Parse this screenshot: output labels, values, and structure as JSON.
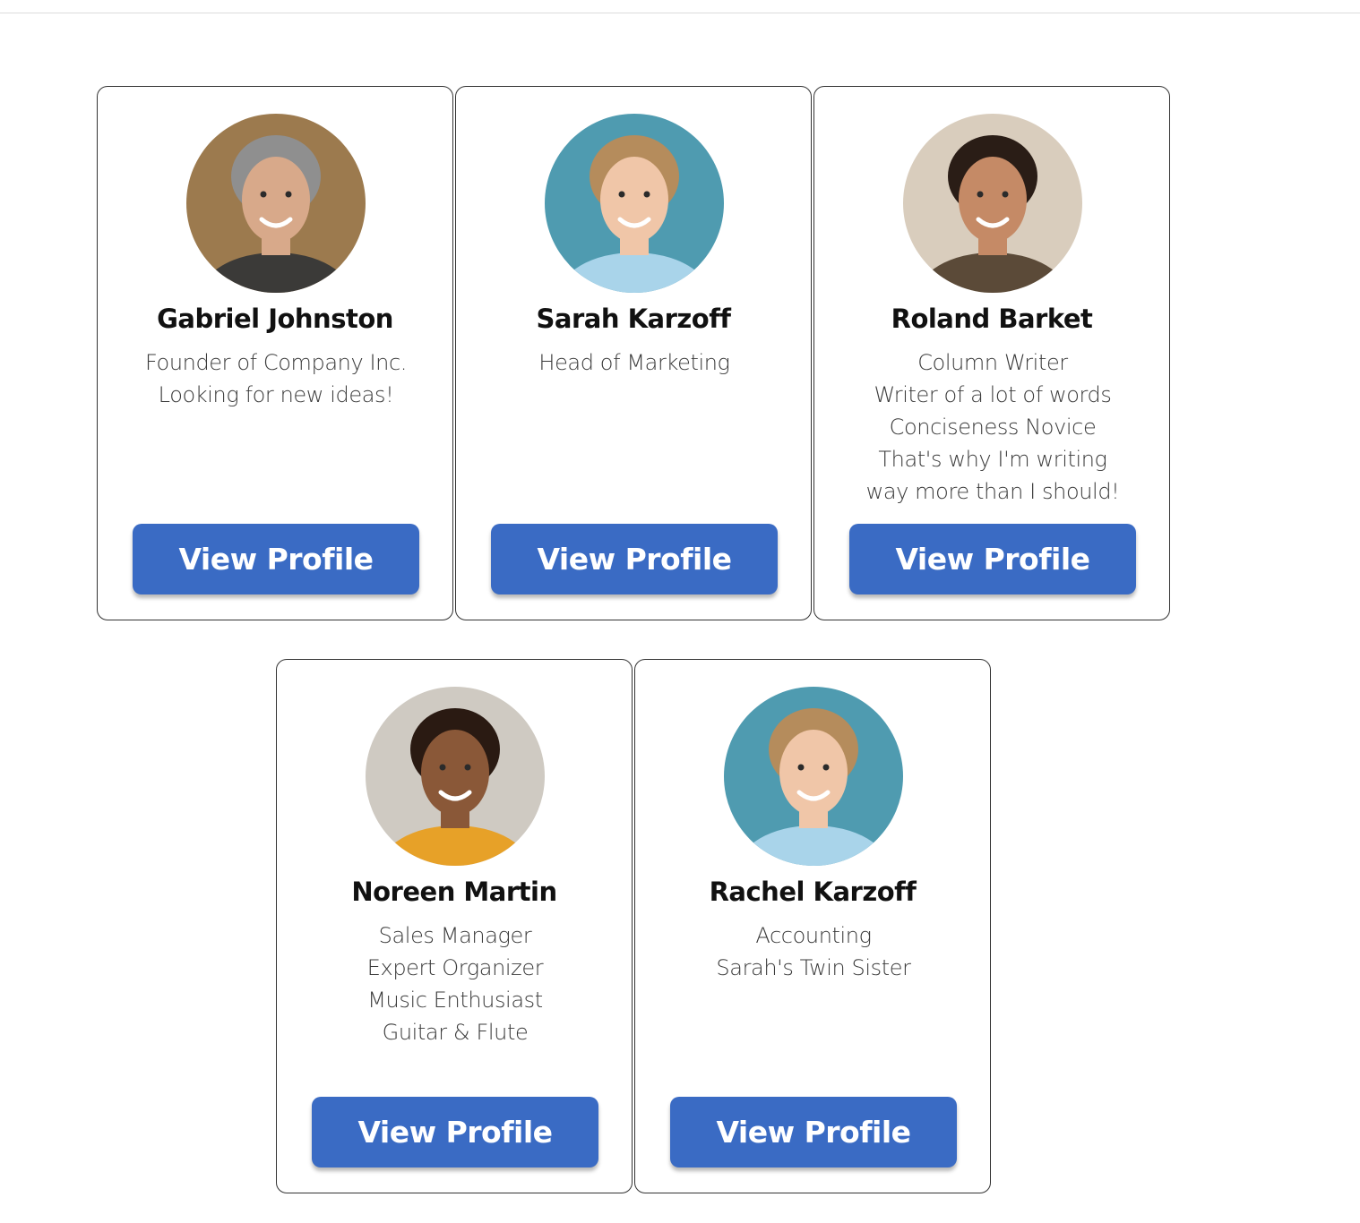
{
  "cards": [
    {
      "name": "Gabriel Johnston",
      "bio": [
        "Founder of Company Inc.",
        "Looking for new ideas!"
      ],
      "button_label": "View Profile",
      "photo": {
        "bg": "#9c7a4e",
        "skin": "#d8a98a",
        "hair": "#8f8f8f",
        "shirt": "#3b3a38"
      }
    },
    {
      "name": "Sarah Karzoff",
      "bio": [
        "Head of Marketing"
      ],
      "button_label": "View Profile",
      "photo": {
        "bg": "#4f9bb0",
        "skin": "#f0c6a8",
        "hair": "#b58c5c",
        "shirt": "#a9d4ea"
      }
    },
    {
      "name": "Roland Barket",
      "bio": [
        "Column Writer",
        "Writer of a lot of words",
        "Conciseness Novice",
        "That's why I'm writing",
        "way more than I should!"
      ],
      "button_label": "View Profile",
      "photo": {
        "bg": "#d9cdbd",
        "skin": "#c58a66",
        "hair": "#2a1d16",
        "shirt": "#5b4a38"
      }
    },
    {
      "name": "Noreen Martin",
      "bio": [
        "Sales Manager",
        "Expert Organizer",
        "Music Enthusiast",
        "Guitar & Flute"
      ],
      "button_label": "View Profile",
      "photo": {
        "bg": "#cfcac2",
        "skin": "#8a5838",
        "hair": "#2a1a12",
        "shirt": "#e7a128"
      }
    },
    {
      "name": "Rachel Karzoff",
      "bio": [
        "Accounting",
        "Sarah's Twin Sister"
      ],
      "button_label": "View Profile",
      "photo": {
        "bg": "#4f9bb0",
        "skin": "#f0c6a8",
        "hair": "#b58c5c",
        "shirt": "#a9d4ea"
      }
    }
  ]
}
